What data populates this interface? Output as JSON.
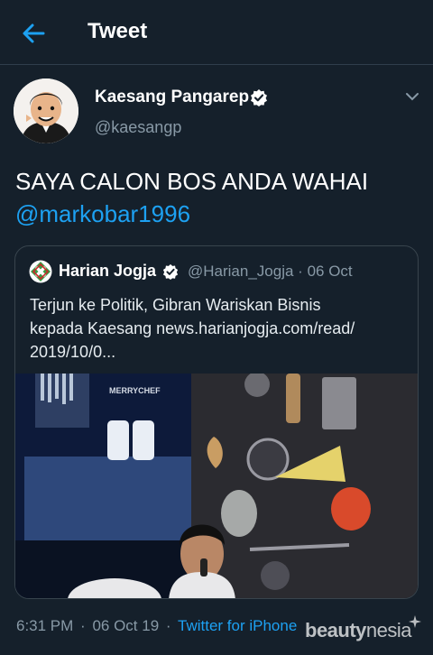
{
  "header": {
    "title": "Tweet",
    "back_icon": "arrow-left-icon"
  },
  "tweet": {
    "author_name": "Kaesang Pangarep",
    "author_handle": "@kaesangp",
    "text_line1": "SAYA CALON BOS ANDA WAHAI",
    "mention": "@markobar1996",
    "time": "6:31 PM",
    "date": "06 Oct 19",
    "separator": "·",
    "source": "Twitter for iPhone"
  },
  "quote": {
    "author_name": "Harian Jogja",
    "author_handle": "@Harian_Jogja",
    "separator": "·",
    "date": "06 Oct",
    "text_lines": [
      "Terjun ke Politik, Gibran Wariskan Bisnis",
      "kepada Kaesang news.harianjogja.com/read/",
      "2019/10/0..."
    ],
    "image_brand_text": "MERRYCHEF"
  },
  "watermark": {
    "brand_bold": "beauty",
    "brand_thin": "nesia"
  },
  "colors": {
    "background": "#15202b",
    "accent": "#1da1f2",
    "muted": "#8899a6",
    "border": "#38444d"
  }
}
